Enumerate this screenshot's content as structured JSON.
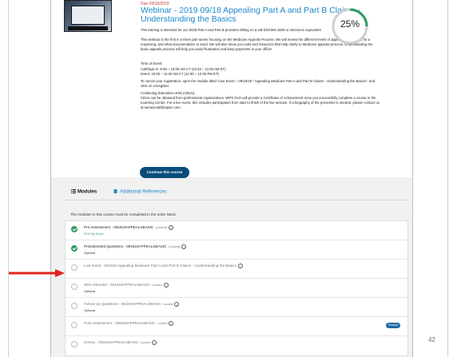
{
  "course": {
    "due_label": "Due 09/18/2019",
    "title": "Webinar - 2019 09/18 Appealing Part A and Part B Claims - Understanding the Basics",
    "progress_label": "25%",
    "progress_fraction": 0.25,
    "progress_color": "#2e9d63",
    "paragraphs": {
      "intended": "This training is intended for our J5/J8 Part A and Part B providers billing on a UB-04/CMS-1500 or electronic equivalent.",
      "first_in_series": "This webinar is the first in a three part series focusing on the Medicare Appeals Process. We will review the different levels of appeals, what to ask for a reopening, and what documentation to send. We will also show you tools and resources that help clarify to Medicare appeals process. Understanding the basic appeals process will help you avoid frustration and keep payments in your office!",
      "time_heading": "Time of Event:",
      "time_call": "Call/Sign-in: 9:45 – 10:00 AM CT (10:45 – 11:00 AM ET)",
      "time_event": "Event: 10:00 – 11:30 AM CT (11:00 – 12:30 PM ET)",
      "cancel": "To cancel your registration, open the module titled \"Live Event – 09/18/19 \" Appealing Medicare Part A and Part B Claims - Understanding the Basics\", and click on Unregister.",
      "ceu_heading": "Continuing Education Units (CEUs)",
      "ceu_body": "CEUs can be obtained from professional organizations. WPS GHA will provide a Certificate of Achievement once you successfully complete a course in the Learning Center. For a live event, this includes participation from start to finish of the live session. If a biography of the presenter is needed, please contact us at surveymail@wpsic.com."
    },
    "continue_button": "Continue this course"
  },
  "tabs": {
    "modules": "Modules",
    "additional_references": "Additional References"
  },
  "modules_note": "The modules in this course must be completed in the order listed.",
  "modules": [
    {
      "name": "Pre Assessment - 091819APPEALSBASIC",
      "lock_label": "(Locked)",
      "sub": "90% My Score",
      "status": "complete"
    },
    {
      "name": "Presubmitted Questions - 091819APPEALSBASIC",
      "lock_label": "(Locked)",
      "sub": "Optional",
      "status": "complete"
    },
    {
      "name": "Live Event - 091819 Appealing Medicare Part A and Part B Claims - Understanding the Basics",
      "lock_label": "",
      "sub": "",
      "status": "incomplete"
    },
    {
      "name": "Who Attended - 091819APPEALSBASIC",
      "lock_label": "Locked",
      "sub": "Optional",
      "status": "incomplete"
    },
    {
      "name": "Follow-Up Questions - 091819APPEALSBASIC",
      "lock_label": "Locked",
      "sub": "Optional",
      "status": "incomplete"
    },
    {
      "name": "Post Assessment - 080819APPEALSBASIC",
      "lock_label": "Locked",
      "sub": "",
      "status": "incomplete",
      "action": "Results"
    },
    {
      "name": "Survey - 091819APPEALSBASIC",
      "lock_label": "Locked",
      "sub": "",
      "status": "incomplete"
    }
  ],
  "annotation_arrow_color": "#e1241b",
  "page_number": "42"
}
